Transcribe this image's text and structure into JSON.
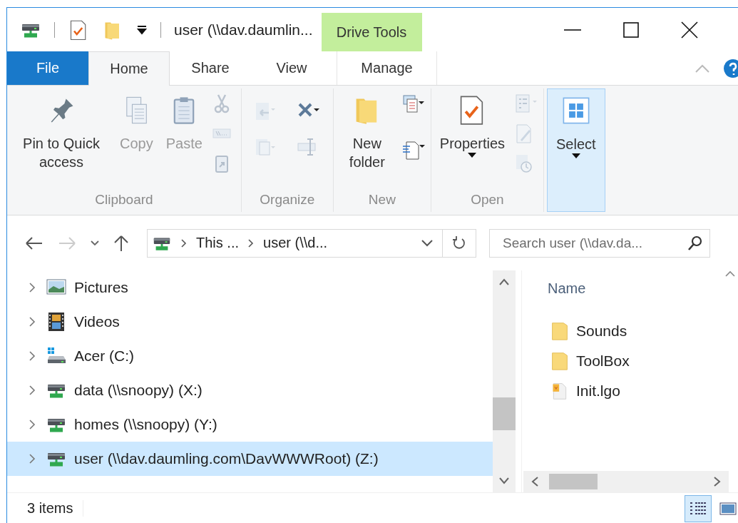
{
  "title_bar": {
    "title": "user (\\\\dav.daumlin...",
    "context_tab": "Drive Tools"
  },
  "tabs": [
    {
      "label": "File",
      "kind": "file",
      "selected": false
    },
    {
      "label": "Home",
      "kind": "normal",
      "selected": true
    },
    {
      "label": "Share",
      "kind": "normal",
      "selected": false
    },
    {
      "label": "View",
      "kind": "normal",
      "selected": false
    },
    {
      "label": "Manage",
      "kind": "context",
      "selected": false
    }
  ],
  "ribbon_groups": [
    {
      "label": "Clipboard",
      "big_buttons": [
        {
          "label": "Pin to Quick access",
          "disabled": false,
          "dropdown": false
        },
        {
          "label": "Copy",
          "disabled": true,
          "dropdown": false
        },
        {
          "label": "Paste",
          "disabled": true,
          "dropdown": false
        }
      ],
      "small_buttons": [
        {
          "disabled": true
        },
        {
          "disabled": true
        },
        {
          "disabled": true
        }
      ]
    },
    {
      "label": "Organize",
      "small_buttons": [
        {
          "disabled": true
        },
        {
          "disabled": true
        },
        {
          "disabled": false
        },
        {
          "disabled": true
        }
      ]
    },
    {
      "label": "New",
      "big_buttons": [
        {
          "label": "New folder",
          "disabled": false,
          "dropdown": false
        }
      ],
      "small_buttons": [
        {
          "disabled": false
        },
        {
          "disabled": false
        }
      ]
    },
    {
      "label": "Open",
      "big_buttons": [
        {
          "label": "Properties",
          "disabled": false,
          "dropdown": true
        }
      ],
      "small_buttons": [
        {
          "disabled": true
        },
        {
          "disabled": true
        },
        {
          "disabled": true
        }
      ]
    },
    {
      "big_buttons": [
        {
          "label": "Select",
          "disabled": false,
          "dropdown": true
        }
      ]
    }
  ],
  "address_bar": {
    "crumbs": [
      "This ...",
      "user (\\\\d..."
    ]
  },
  "search": {
    "placeholder": "Search user (\\\\dav.da..."
  },
  "nav_tree": [
    {
      "label": "Pictures",
      "kind": "pictures",
      "selected": false
    },
    {
      "label": "Videos",
      "kind": "videos",
      "selected": false
    },
    {
      "label": "Acer (C:)",
      "kind": "local-drive",
      "selected": false
    },
    {
      "label": "data (\\\\snoopy) (X:)",
      "kind": "network-drive",
      "selected": false
    },
    {
      "label": "homes (\\\\snoopy) (Y:)",
      "kind": "network-drive",
      "selected": false
    },
    {
      "label": "user (\\\\dav.daumling.com\\DavWWWRoot) (Z:)",
      "kind": "network-drive",
      "selected": true
    }
  ],
  "file_list": {
    "columns": [
      "Name"
    ],
    "rows": [
      {
        "name": "Sounds",
        "kind": "folder"
      },
      {
        "name": "ToolBox",
        "kind": "folder"
      },
      {
        "name": "Init.lgo",
        "kind": "file"
      }
    ]
  },
  "status_bar": {
    "count": "3 items",
    "views": [
      {
        "kind": "details",
        "selected": true
      },
      {
        "kind": "large-icons",
        "selected": false
      }
    ]
  }
}
